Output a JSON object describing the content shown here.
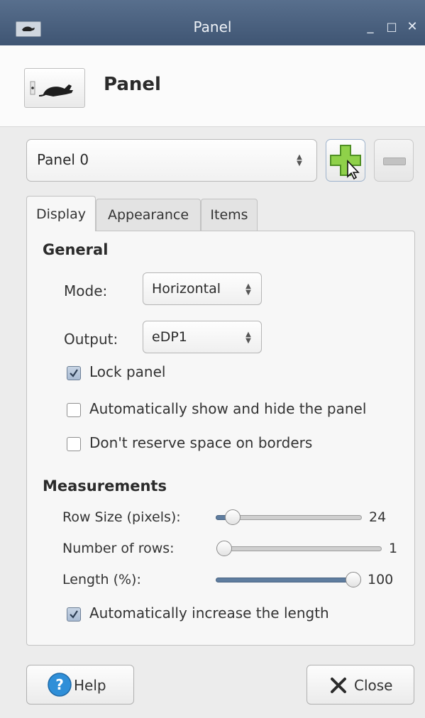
{
  "window": {
    "title": "Panel"
  },
  "titlebar": {
    "minimize": "_",
    "maximize": "□",
    "close": "✕"
  },
  "header": {
    "title": "Panel",
    "icon": "panel-mouse-icon"
  },
  "panel_selector": {
    "value": "Panel 0",
    "add_icon": "plus-icon",
    "remove_icon": "minus-icon"
  },
  "tabs": [
    {
      "label": "Display",
      "active": true
    },
    {
      "label": "Appearance",
      "active": false
    },
    {
      "label": "Items",
      "active": false
    }
  ],
  "general": {
    "title": "General",
    "mode": {
      "label": "Mode:",
      "value": "Horizontal"
    },
    "output": {
      "label": "Output:",
      "value": "eDP1"
    },
    "lock_panel": {
      "label": "Lock panel",
      "checked": true
    },
    "autohide": {
      "label": "Automatically show and hide the panel",
      "checked": false
    },
    "no_reserve": {
      "label": "Don't reserve space on borders",
      "checked": false
    }
  },
  "measurements": {
    "title": "Measurements",
    "row_size": {
      "label": "Row Size (pixels):",
      "value": "24",
      "fraction": 0.1
    },
    "rows": {
      "label": "Number of rows:",
      "value": "1",
      "fraction": 0.0
    },
    "length": {
      "label": "Length (%):",
      "value": "100",
      "fraction": 1.0
    },
    "auto_length": {
      "label": "Automatically increase the length",
      "checked": true
    }
  },
  "buttons": {
    "help": "Help",
    "close": "Close"
  },
  "colors": {
    "titlebar": "#4a6080",
    "accent": "#5f7d9f",
    "help": "#2f8fd8"
  }
}
